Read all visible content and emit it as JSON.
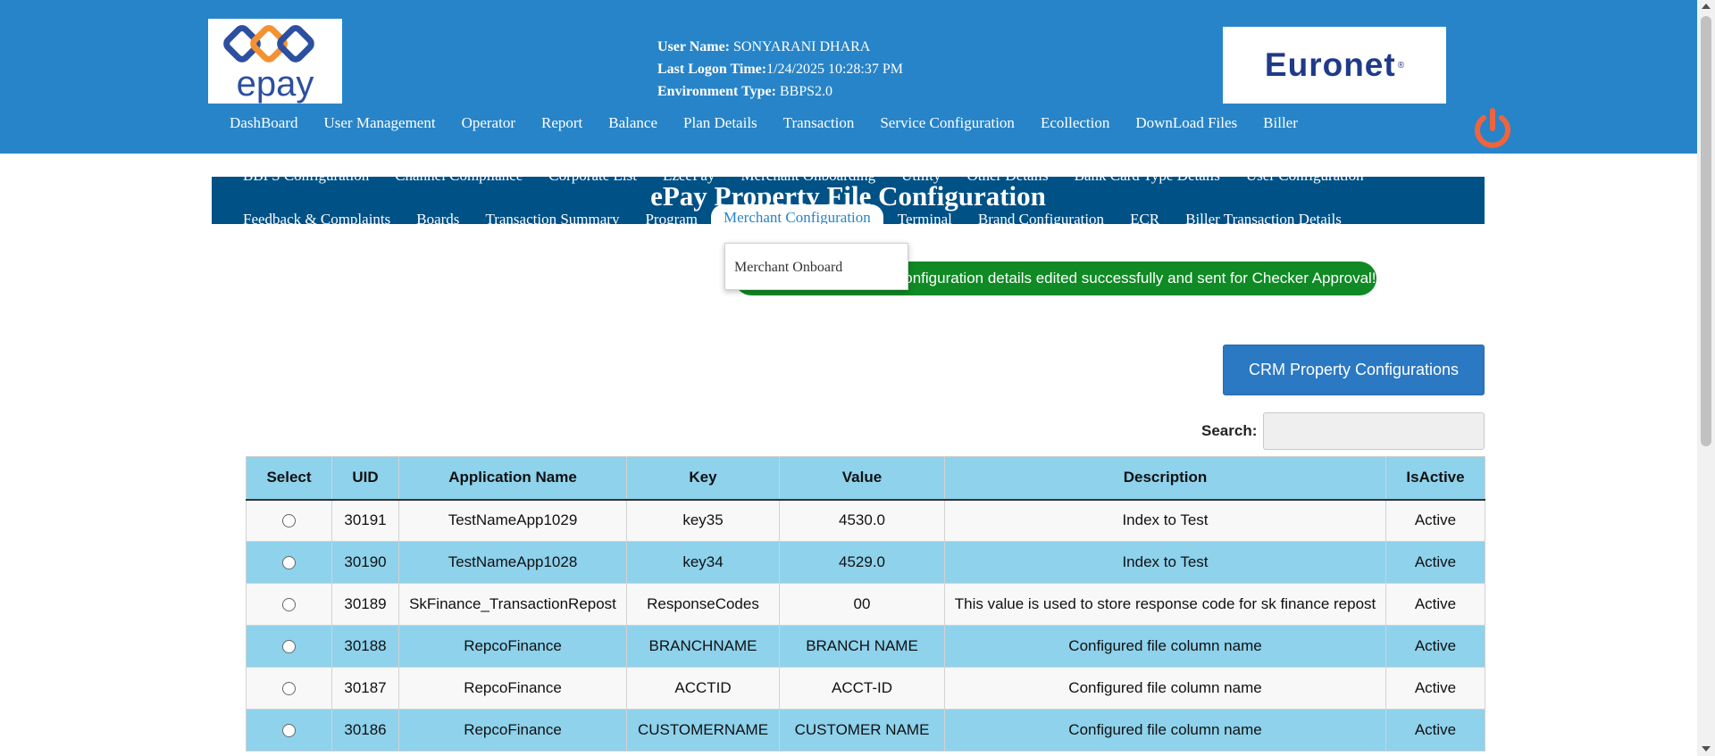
{
  "header": {
    "logo_left": {
      "text": "epay",
      "icon": "epay-logo-icon"
    },
    "logo_right": {
      "text": "Euronet",
      "mark": "®"
    },
    "user_label": "User Name:",
    "user_value": " SONYARANI DHARA",
    "logon_label": "Last Logon Time:",
    "logon_value": "1/24/2025 10:28:37 PM",
    "env_label": "Environment Type:",
    "env_value": " BBPS2.0",
    "power_icon": "power-icon",
    "nav": [
      "DashBoard",
      "User Management",
      "Operator",
      "Report",
      "Balance",
      "Plan Details",
      "Transaction",
      "Service Configuration",
      "Ecollection",
      "DownLoad Files",
      "Biller"
    ]
  },
  "band": {
    "title": "ePay Property File Configuration",
    "ghost_nav": [
      "BBPS Configuration",
      "Channel Compliance",
      "Corporate List",
      "EzeePay",
      "Merchant Onboarding",
      "Utility",
      "Other Details",
      "Bank Card Type Details",
      "User Configuration"
    ],
    "subnav": [
      "Feedback & Complaints",
      "Boards",
      "Transaction Summary",
      "Program",
      "Merchant Configuration",
      "Terminal",
      "Brand Configuration",
      "ECR",
      "Biller Transaction Details"
    ],
    "active_index": 4
  },
  "dropdown": {
    "items": [
      "Merchant Onboard"
    ]
  },
  "message": {
    "text": "Configuration details edited successfully and sent for Checker Approval!",
    "color": "#0f8a24"
  },
  "crm_button": {
    "label": "CRM Property Configurations"
  },
  "search": {
    "label": "Search:",
    "value": "",
    "placeholder": ""
  },
  "table": {
    "columns": [
      "Select",
      "UID",
      "Application Name",
      "Key",
      "Value",
      "Description",
      "IsActive"
    ],
    "rows": [
      [
        "30191",
        "TestNameApp1029",
        "key35",
        "4530.0",
        "Index to Test",
        "Active"
      ],
      [
        "30190",
        "TestNameApp1028",
        "key34",
        "4529.0",
        "Index to Test",
        "Active"
      ],
      [
        "30189",
        "SkFinance_TransactionRepost",
        "ResponseCodes",
        "00",
        "This value is used to store response code for sk finance repost",
        "Active"
      ],
      [
        "30188",
        "RepcoFinance",
        "BRANCHNAME",
        "BRANCH NAME",
        "Configured file column name",
        "Active"
      ],
      [
        "30187",
        "RepcoFinance",
        "ACCTID",
        "ACCT-ID",
        "Configured file column name",
        "Active"
      ],
      [
        "30186",
        "RepcoFinance",
        "CUSTOMERNAME",
        "CUSTOMER NAME",
        "Configured file column name",
        "Active"
      ]
    ]
  },
  "colors": {
    "header_bg": "#2784c8",
    "band_bg": "#005186",
    "row_alt": "#8ed2ec",
    "power": "#f0643c",
    "button": "#2b78c3"
  }
}
